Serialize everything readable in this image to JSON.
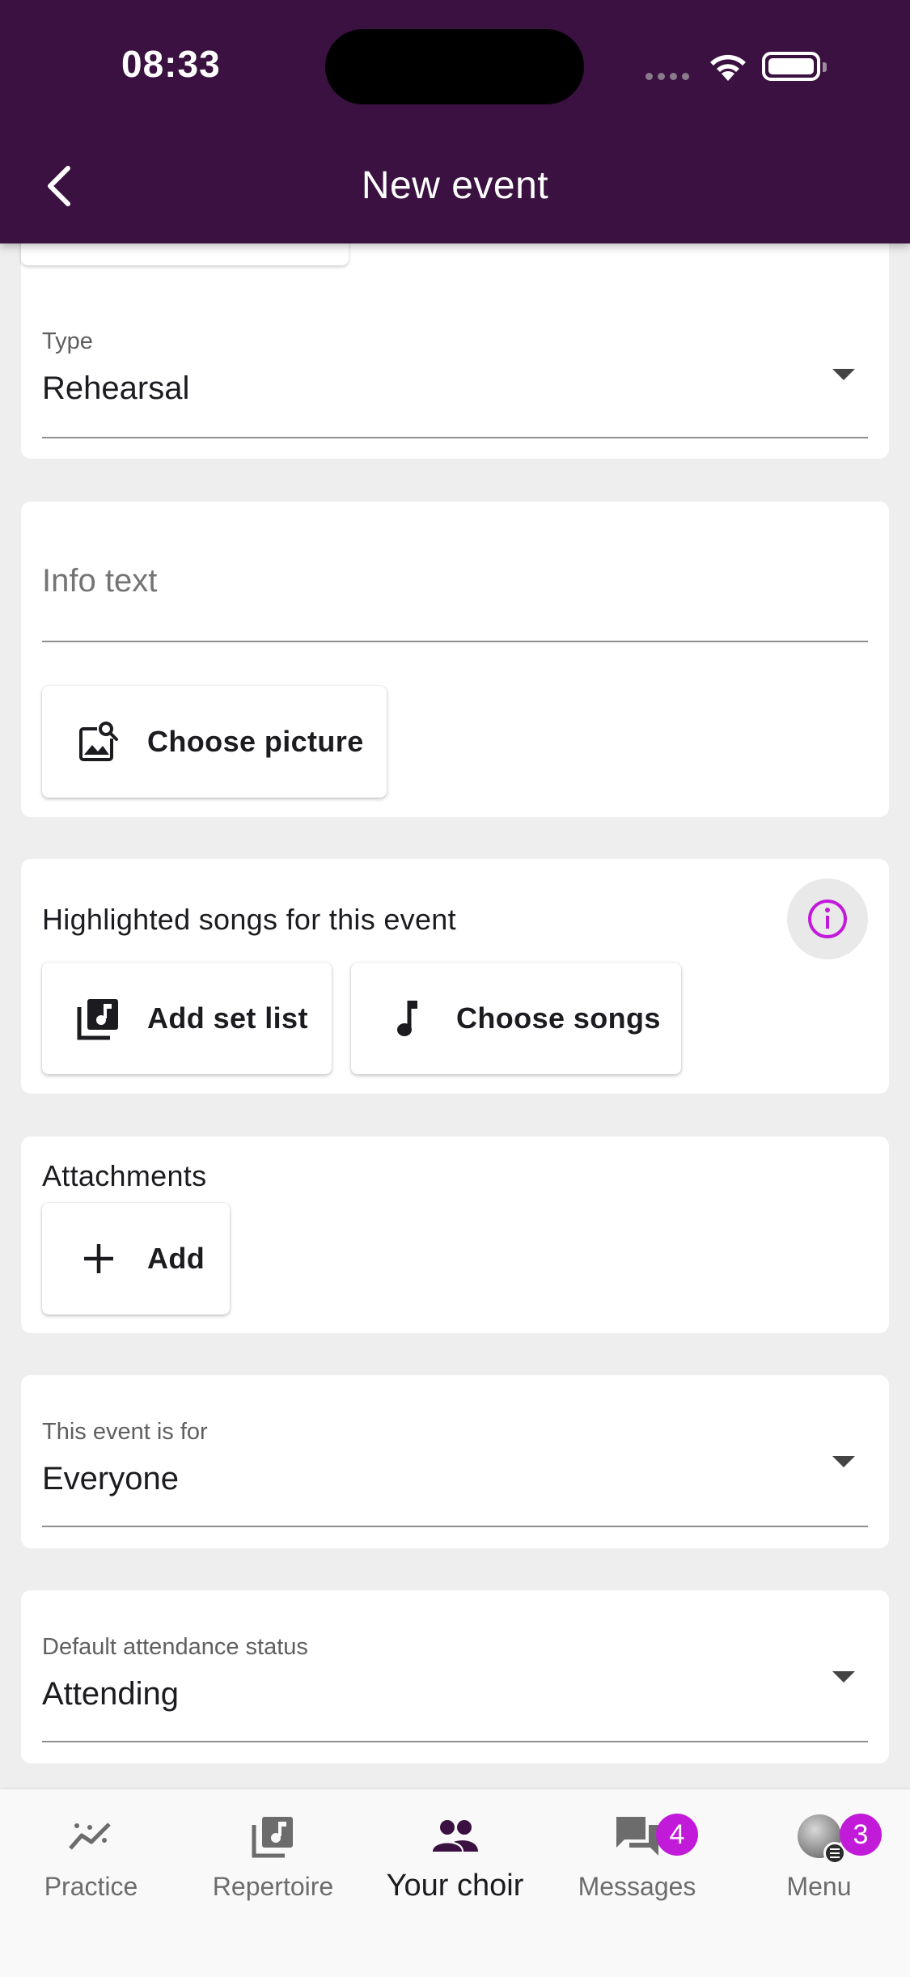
{
  "status_bar": {
    "time": "08:33"
  },
  "header": {
    "title": "New event"
  },
  "type_field": {
    "label": "Type",
    "value": "Rehearsal"
  },
  "info_card": {
    "info_placeholder": "Info text",
    "choose_picture_label": "Choose picture"
  },
  "songs_card": {
    "title": "Highlighted songs for this event",
    "add_set_list_label": "Add set list",
    "choose_songs_label": "Choose songs"
  },
  "attachments_card": {
    "title": "Attachments",
    "add_label": "Add"
  },
  "audience_field": {
    "label": "This event is for",
    "value": "Everyone"
  },
  "attendance_field": {
    "label": "Default attendance status",
    "value": "Attending"
  },
  "bottom_nav": {
    "items": [
      {
        "label": "Practice",
        "icon": "practice-chart-icon"
      },
      {
        "label": "Repertoire",
        "icon": "music-library-icon"
      },
      {
        "label": "Your choir",
        "icon": "group-icon",
        "active": true
      },
      {
        "label": "Messages",
        "icon": "chat-icon",
        "badge": "4"
      },
      {
        "label": "Menu",
        "icon": "avatar",
        "badge": "3"
      }
    ]
  },
  "colors": {
    "header_bg": "#3a1140",
    "accent": "#c21ad9",
    "page_bg": "#eeeeee"
  }
}
